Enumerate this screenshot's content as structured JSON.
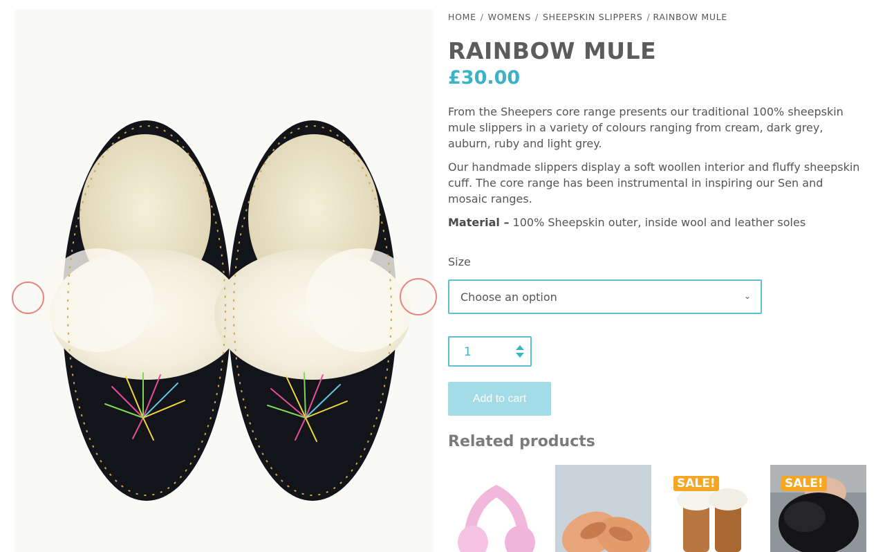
{
  "breadcrumb": {
    "items": [
      "HOME",
      "WOMENS",
      "SHEEPSKIN SLIPPERS",
      "RAINBOW MULE"
    ],
    "separator": "/"
  },
  "product": {
    "title": "RAINBOW MULE",
    "price": "£30.00",
    "description_1": "From the Sheepers core range presents our traditional 100% sheepskin mule slippers in a variety of colours ranging from cream, dark grey, auburn, ruby and light grey.",
    "description_2": "Our handmade slippers display a soft woollen interior and fluffy sheepskin cuff. The core range has been instrumental in inspiring our Sen and mosaic ranges.",
    "material_label": "Material –",
    "material_value": " 100% Sheepskin outer, inside wool and leather soles"
  },
  "form": {
    "size_label": "Size",
    "size_selected": "Choose an option",
    "quantity": "1",
    "add_to_cart": "Add to cart"
  },
  "related": {
    "title": "Related products",
    "items": [
      {
        "sale_badge": ""
      },
      {
        "sale_badge": ""
      },
      {
        "sale_badge": "SALE!"
      },
      {
        "sale_badge": "SALE!"
      }
    ]
  },
  "colors": {
    "accent": "#3bb2c7",
    "button": "#a3dbe6",
    "sale": "#f5a623",
    "gallery_nav": "#e8857f"
  },
  "icons": {
    "gallery_prev": "chevron-left-circle-icon",
    "gallery_next": "chevron-right-circle-icon",
    "select": "chevron-down-icon",
    "quantity": "spinner-arrows-icon"
  }
}
